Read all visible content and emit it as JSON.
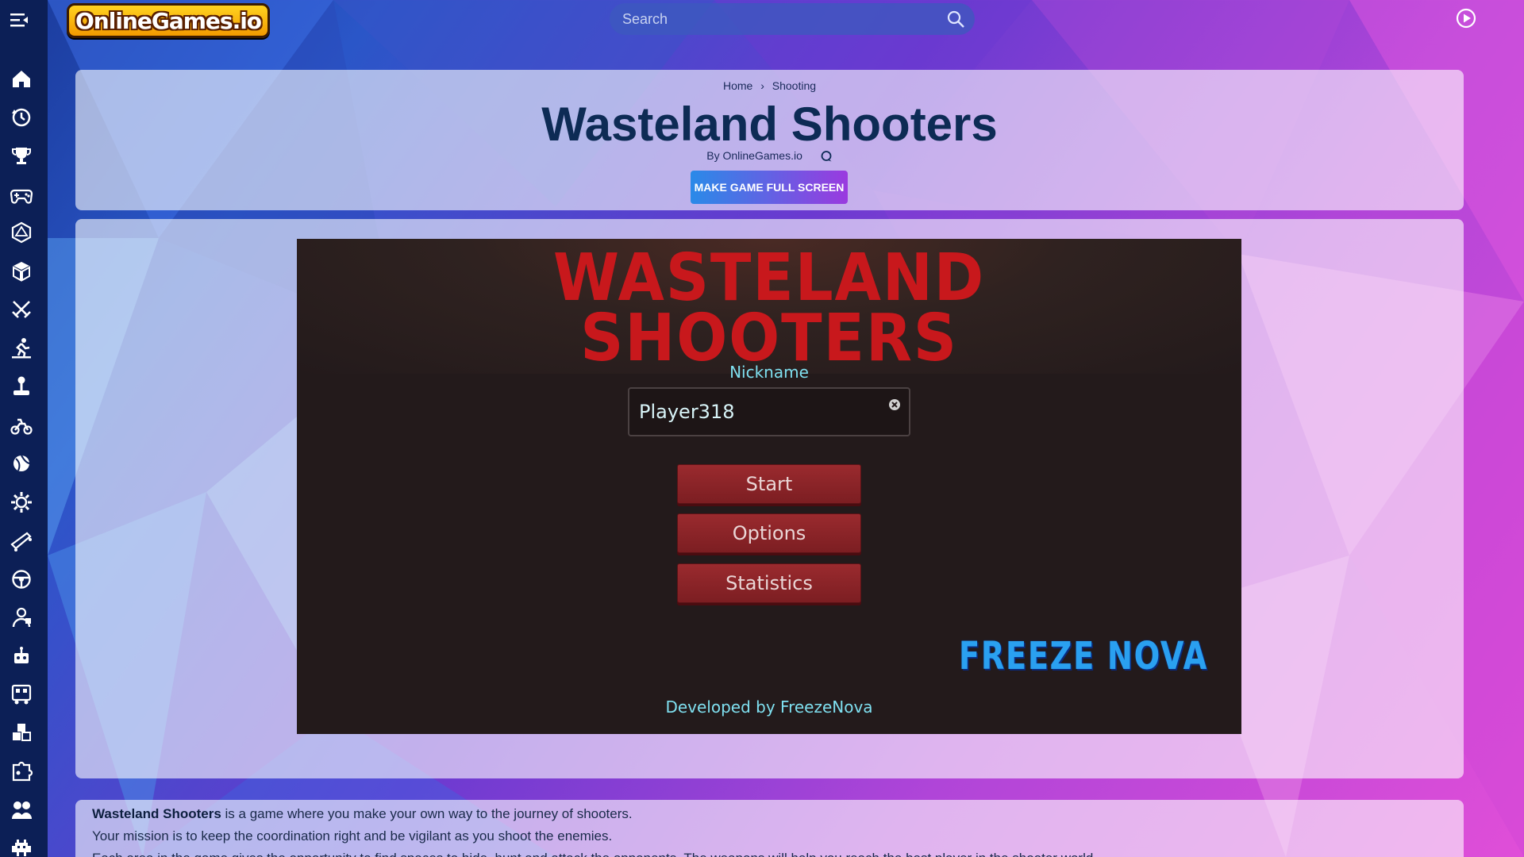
{
  "header": {
    "logo_text": "OnlineGames.io",
    "search_placeholder": "Search"
  },
  "sidebar": {
    "items": [
      {
        "icon": "home-icon"
      },
      {
        "icon": "history-icon"
      },
      {
        "icon": "trophy-icon"
      },
      {
        "icon": "gamepad-icon"
      },
      {
        "icon": "d20-dice-icon"
      },
      {
        "icon": "cube-games-icon"
      },
      {
        "icon": "crossed-swords-icon"
      },
      {
        "icon": "runner-icon"
      },
      {
        "icon": "joystick-icon"
      },
      {
        "icon": "motorbike-icon"
      },
      {
        "icon": "ball-icon"
      },
      {
        "icon": "gear-icon"
      },
      {
        "icon": "skateboard-icon"
      },
      {
        "icon": "steering-wheel-icon"
      },
      {
        "icon": "character-icon"
      },
      {
        "icon": "robot-icon"
      },
      {
        "icon": "train-icon"
      },
      {
        "icon": "blocks-icon"
      },
      {
        "icon": "puzzle-icon"
      },
      {
        "icon": "couple-icon"
      },
      {
        "icon": "alien-icon"
      }
    ]
  },
  "breadcrumb": {
    "home": "Home",
    "separator": "›",
    "category": "Shooting"
  },
  "game_page": {
    "title": "Wasteland Shooters",
    "byline": "By OnlineGames.io",
    "fullscreen_button": "MAKE GAME FULL SCREEN"
  },
  "game": {
    "logo_line1": "WASTELAND",
    "logo_line2": "SHOOTERS",
    "nickname_label": "Nickname",
    "nickname_value": "Player318",
    "buttons": {
      "start": "Start",
      "options": "Options",
      "statistics": "Statistics"
    },
    "dev_logo": "FREEZE NOVA",
    "dev_credit": "Developed by FreezeNova"
  },
  "description": {
    "title_bold": "Wasteland Shooters",
    "line1_rest": " is a game where you make your own way to the journey of shooters.",
    "line2": "Your mission is to keep the coordination right and be vigilant as you shoot the enemies.",
    "line3": "Each area in the game gives the opportunity to find spaces to hide, hunt and attack the opponents. The weapons will help you reach the best player in the shooter world."
  },
  "colors": {
    "sidebar": "#0c1f56",
    "title": "#0d2b55",
    "game_bg": "#231a1b",
    "game_logo": "#c8181c",
    "game_text": "#7fe0f0",
    "menu_button": "#8a2428"
  }
}
